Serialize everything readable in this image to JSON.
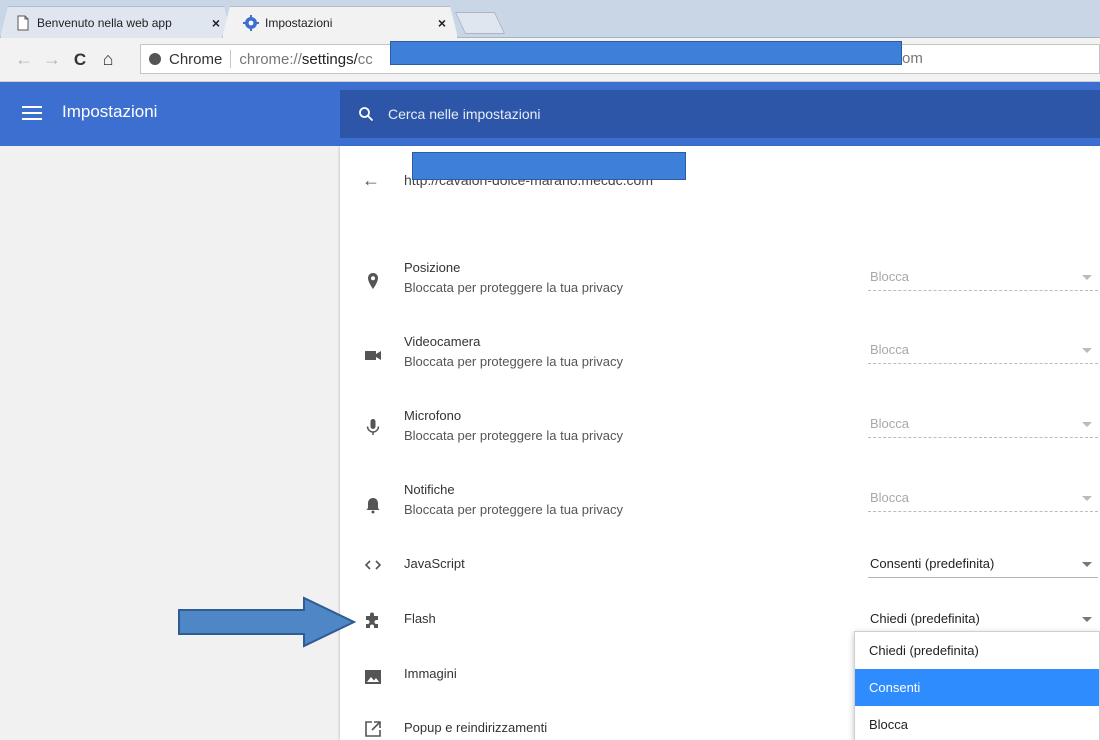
{
  "browser": {
    "tabs": [
      {
        "title": "Benvenuto nella web app",
        "active": false
      },
      {
        "title": "Impostazioni",
        "active": true
      }
    ],
    "close_glyph": "×",
    "nav": {
      "back": "←",
      "forward": "→",
      "reload": "C",
      "home": "⌂"
    },
    "omnibox": {
      "chip_label": "Chrome",
      "url_prefix": "chrome://",
      "url_bold": "settings/",
      "url_rest": "cc",
      "url_tail": "om"
    }
  },
  "settings": {
    "header_title": "Impostazioni",
    "search_placeholder": "Cerca nelle impostazioni",
    "site_url": "http://cavalon-dolce-marano.mecdc.com",
    "permissions": [
      {
        "name": "Posizione",
        "sub": "Bloccata per proteggere la tua privacy",
        "value": "Blocca",
        "icon": "location-pin-icon",
        "disabled": true
      },
      {
        "name": "Videocamera",
        "sub": "Bloccata per proteggere la tua privacy",
        "value": "Blocca",
        "icon": "videocam-icon",
        "disabled": true
      },
      {
        "name": "Microfono",
        "sub": "Bloccata per proteggere la tua privacy",
        "value": "Blocca",
        "icon": "microphone-icon",
        "disabled": true
      },
      {
        "name": "Notifiche",
        "sub": "Bloccata per proteggere la tua privacy",
        "value": "Blocca",
        "icon": "bell-icon",
        "disabled": true
      },
      {
        "name": "JavaScript",
        "sub": "",
        "value": "Consenti (predefinita)",
        "icon": "code-icon",
        "disabled": false
      },
      {
        "name": "Flash",
        "sub": "",
        "value": "Chiedi (predefinita)",
        "icon": "puzzle-icon",
        "disabled": false
      },
      {
        "name": "Immagini",
        "sub": "",
        "value": "",
        "icon": "image-icon",
        "disabled": false
      },
      {
        "name": "Popup e reindirizzamenti",
        "sub": "",
        "value": "",
        "icon": "open-in-new-icon",
        "disabled": false
      }
    ],
    "flash_dropdown": {
      "options": [
        "Chiedi (predefinita)",
        "Consenti",
        "Blocca"
      ],
      "highlighted": "Consenti"
    }
  },
  "colors": {
    "header_blue": "#3d6fd0",
    "search_blue": "#2e56a8",
    "highlight_blue": "#2f8cff",
    "annotation_arrow": "#4f86c6"
  }
}
